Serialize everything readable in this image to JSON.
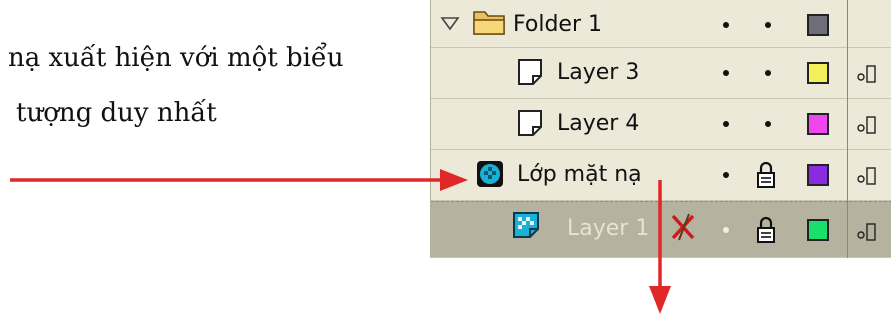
{
  "caption": {
    "line1": "nạ xuất hiện với một biểu",
    "line2": " tượng duy nhất"
  },
  "layers": [
    {
      "name": "Folder 1",
      "icon": "folder-icon",
      "color": "#6e6e78",
      "locked": false
    },
    {
      "name": "Layer 3",
      "icon": "layer-page-icon",
      "color": "#f4f05c",
      "locked": false
    },
    {
      "name": "Layer 4",
      "icon": "layer-page-icon",
      "color": "#ef46ef",
      "locked": false
    },
    {
      "name": "Lớp mặt nạ",
      "icon": "mask-layer-icon",
      "color": "#8a2be2",
      "locked": true
    },
    {
      "name": "Layer 1",
      "icon": "masked-layer-icon",
      "color": "#18e06a",
      "locked": true,
      "selected": true
    }
  ],
  "colors": {
    "panel": "#ece9d8",
    "selected_row": "#b5b39f",
    "arrow": "#e02828"
  }
}
